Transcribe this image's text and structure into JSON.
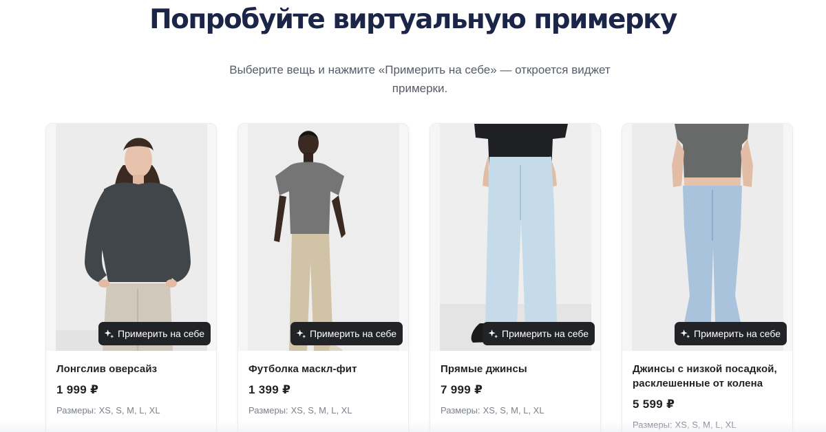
{
  "header": {
    "title": "Попробуйте виртуальную примерку",
    "subtitle": "Выберите вещь и нажмите «Примерить на себе» — откроется виджет примерки."
  },
  "ui": {
    "try_on_label": "Примерить на себе",
    "try_on_icon": "sparkle-icon",
    "sizes_label": "Размеры:"
  },
  "colors": {
    "title": "#1b2547",
    "button_bg": "#222326",
    "button_text": "#ffffff",
    "text_dark": "#1f2125",
    "text_muted": "#7b808a"
  },
  "products": [
    {
      "name": "Лонгслив оверсайз",
      "price": "1 999 ₽",
      "sizes": [
        "XS",
        "S",
        "M",
        "L",
        "XL"
      ]
    },
    {
      "name": "Футболка маскл-фит",
      "price": "1 399 ₽",
      "sizes": [
        "XS",
        "S",
        "M",
        "L",
        "XL"
      ]
    },
    {
      "name": "Прямые джинсы",
      "price": "7 999 ₽",
      "sizes": [
        "XS",
        "S",
        "M",
        "L",
        "XL"
      ]
    },
    {
      "name": "Джинсы с низкой посадкой, расклешенные от колена",
      "price": "5 599 ₽",
      "sizes": [
        "XS",
        "S",
        "M",
        "L",
        "XL"
      ]
    }
  ]
}
